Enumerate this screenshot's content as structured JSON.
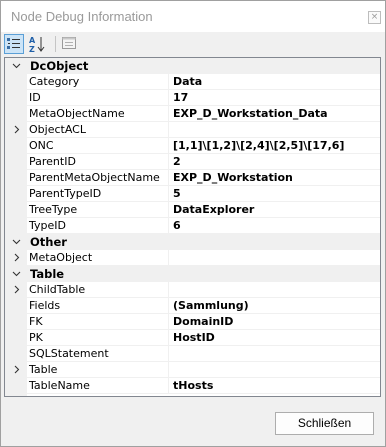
{
  "window": {
    "title": "Node Debug Information",
    "close_glyph": "×"
  },
  "toolbar": {
    "categorized_icon": "categorized-view-icon",
    "alphabetical_icon": "alphabetical-sort-icon",
    "property_pages_icon": "property-pages-icon"
  },
  "grid": {
    "categories": [
      {
        "name": "DcObject",
        "rows": [
          {
            "name": "Category",
            "value": "Data",
            "expandable": false
          },
          {
            "name": "ID",
            "value": "17",
            "expandable": false
          },
          {
            "name": "MetaObjectName",
            "value": "EXP_D_Workstation_Data",
            "expandable": false
          },
          {
            "name": "ObjectACL",
            "value": "",
            "expandable": true
          },
          {
            "name": "ONC",
            "value": "[1,1]\\[1,2]\\[2,4]\\[2,5]\\[17,6]",
            "expandable": false
          },
          {
            "name": "ParentID",
            "value": "2",
            "expandable": false
          },
          {
            "name": "ParentMetaObjectName",
            "value": "EXP_D_Workstation",
            "expandable": false
          },
          {
            "name": "ParentTypeID",
            "value": "5",
            "expandable": false
          },
          {
            "name": "TreeType",
            "value": "DataExplorer",
            "expandable": false
          },
          {
            "name": "TypeID",
            "value": "6",
            "expandable": false
          }
        ]
      },
      {
        "name": "Other",
        "rows": [
          {
            "name": "MetaObject",
            "value": "",
            "expandable": true
          }
        ]
      },
      {
        "name": "Table",
        "rows": [
          {
            "name": "ChildTable",
            "value": "",
            "expandable": true
          },
          {
            "name": "Fields",
            "value": "(Sammlung)",
            "expandable": false
          },
          {
            "name": "FK",
            "value": "DomainID",
            "expandable": false
          },
          {
            "name": "PK",
            "value": "HostID",
            "expandable": false
          },
          {
            "name": "SQLStatement",
            "value": "",
            "expandable": false
          },
          {
            "name": "Table",
            "value": "",
            "expandable": true
          },
          {
            "name": "TableName",
            "value": "tHosts",
            "expandable": false
          }
        ]
      }
    ]
  },
  "footer": {
    "close_label": "Schließen"
  }
}
